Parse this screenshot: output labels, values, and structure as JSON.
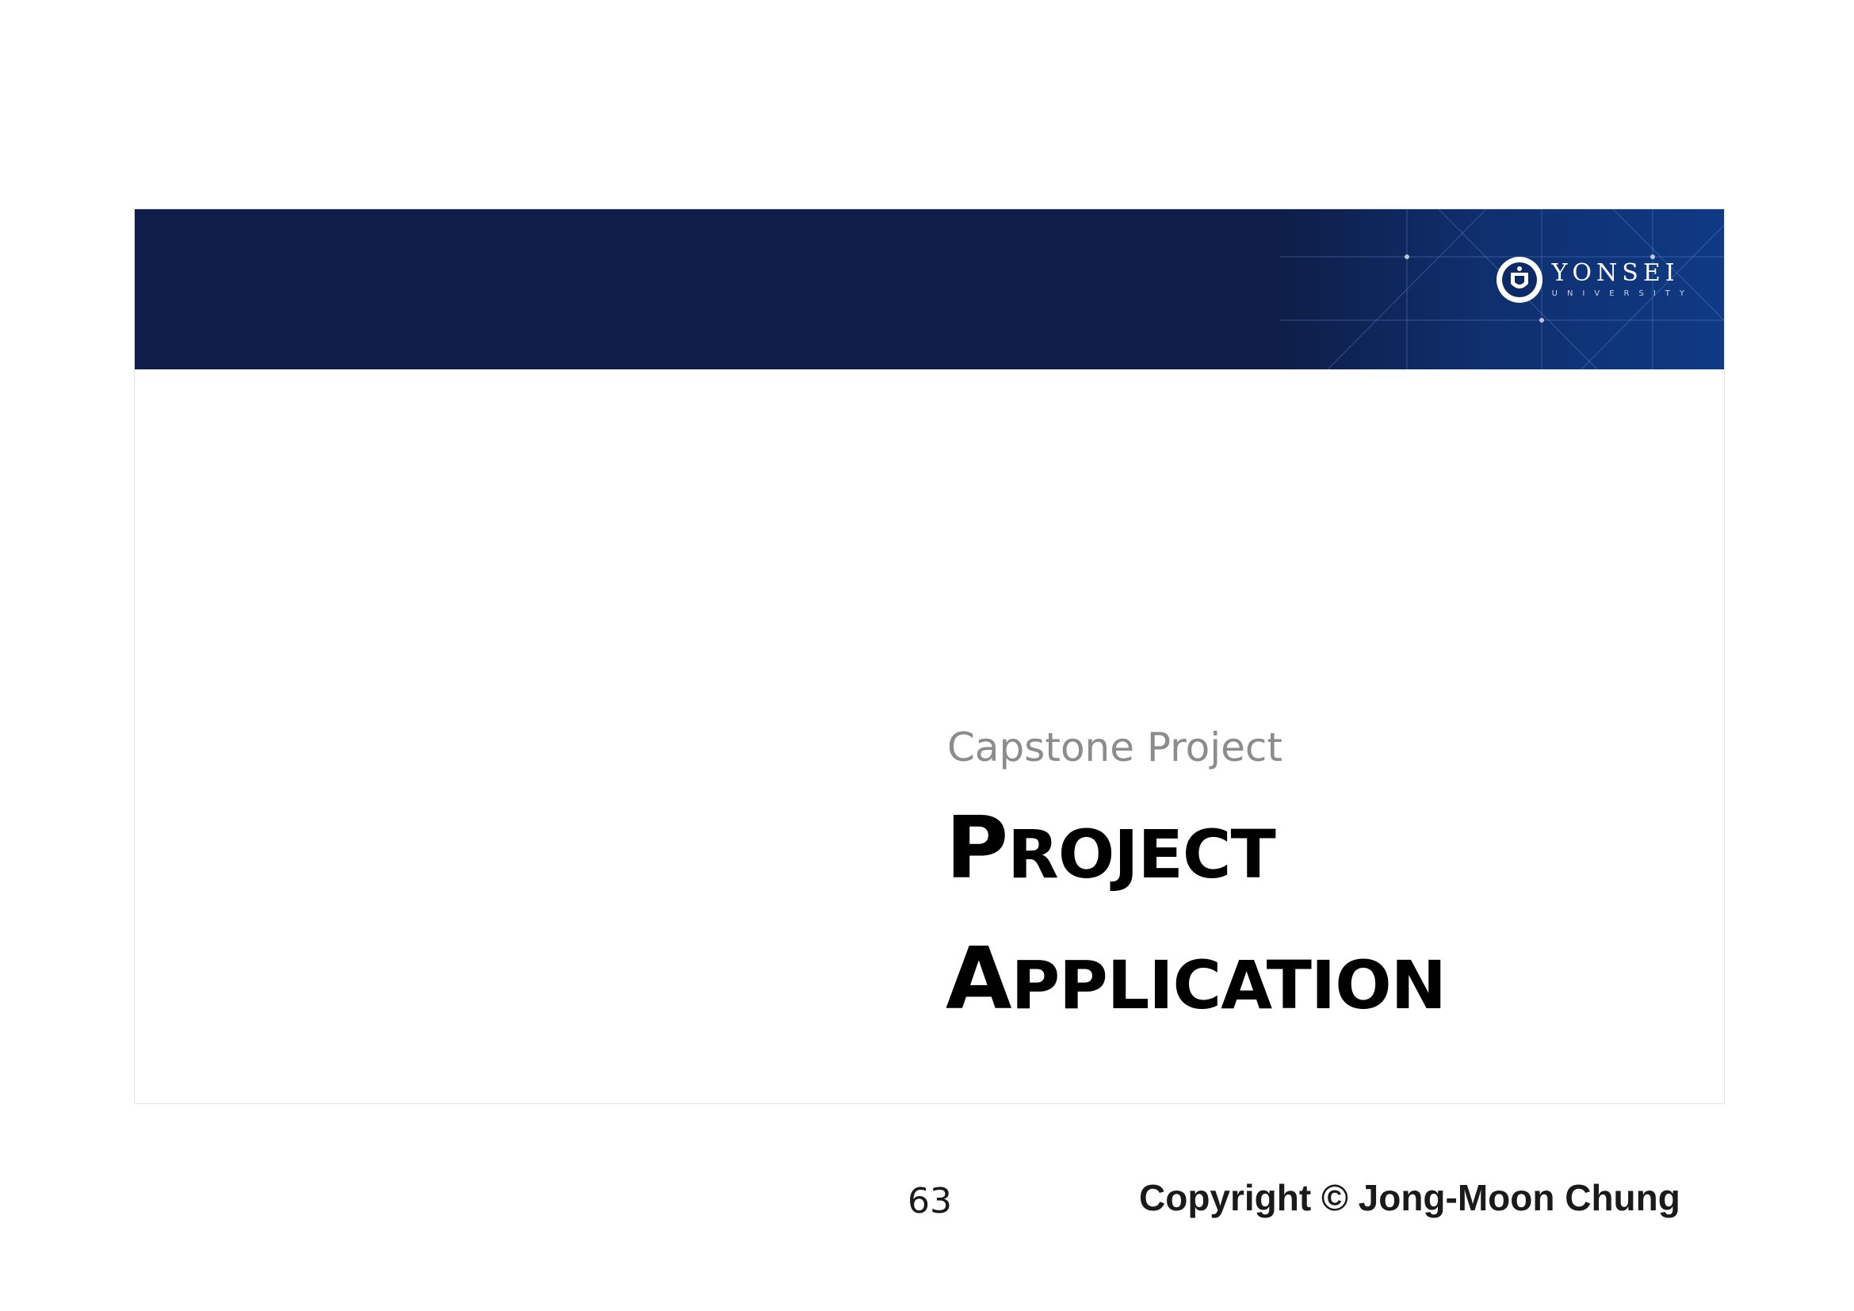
{
  "header": {
    "logo": {
      "name": "YONSEI",
      "sub": "UNIVERSITY"
    },
    "colors": {
      "band_dark": "#0e1e48",
      "band_light": "#0f3a84"
    }
  },
  "content": {
    "subtitle": "Capstone Project",
    "title_lines": [
      {
        "cap": "P",
        "rest": "roject"
      },
      {
        "cap": "A",
        "rest": "pplication"
      }
    ]
  },
  "footer": {
    "page_number": "63",
    "copyright": "Copyright © Jong-Moon Chung"
  }
}
